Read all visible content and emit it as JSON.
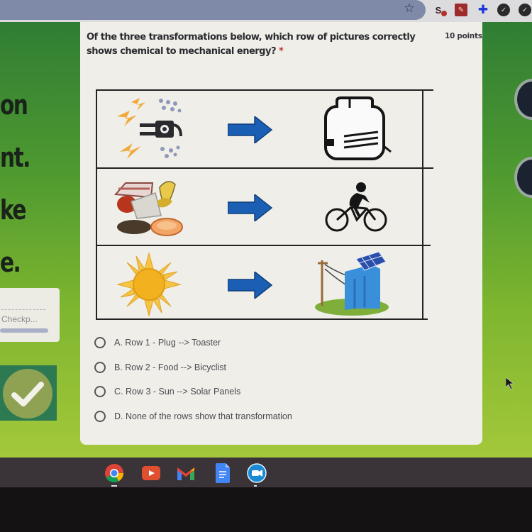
{
  "browser": {
    "toolbar_icons": [
      "bookmark-star-icon",
      "extension-1-icon",
      "extension-2-icon",
      "extensions-puzzle-icon",
      "extension-4-icon",
      "extension-5-icon"
    ]
  },
  "background_panel": {
    "text_lines": [
      "on",
      "nt.",
      "ke",
      "e."
    ],
    "checkpoint_label": "Checkp...",
    "check_tile_icon": "checkmark-icon"
  },
  "question": {
    "title": "Of the three transformations below, which row of pictures correctly shows chemical to mechanical energy?",
    "required_marker": "*",
    "points": "10 points",
    "image_rows": [
      {
        "left": "plug-electricity-image",
        "arrow": "right-arrow",
        "right": "toaster-image"
      },
      {
        "left": "food-image",
        "arrow": "right-arrow",
        "right": "bicyclist-image"
      },
      {
        "left": "sun-image",
        "arrow": "right-arrow",
        "right": "solar-panels-image"
      }
    ],
    "options": [
      {
        "label": "A. Row 1 - Plug --> Toaster",
        "selected": false
      },
      {
        "label": "B. Row 2 - Food --> Bicyclist",
        "selected": false
      },
      {
        "label": "C. Row 3 - Sun --> Solar Panels",
        "selected": false
      },
      {
        "label": "D. None of the rows show that transformation",
        "selected": false
      }
    ]
  },
  "shelf": {
    "apps": [
      "chrome-icon",
      "youtube-icon",
      "gmail-icon",
      "docs-icon",
      "zoom-icon"
    ]
  },
  "colors": {
    "accent_arrow": "#1a5fb4",
    "required": "#c0392b",
    "page_green_top": "#2f7d34",
    "page_green_bottom": "#a4c83a"
  }
}
